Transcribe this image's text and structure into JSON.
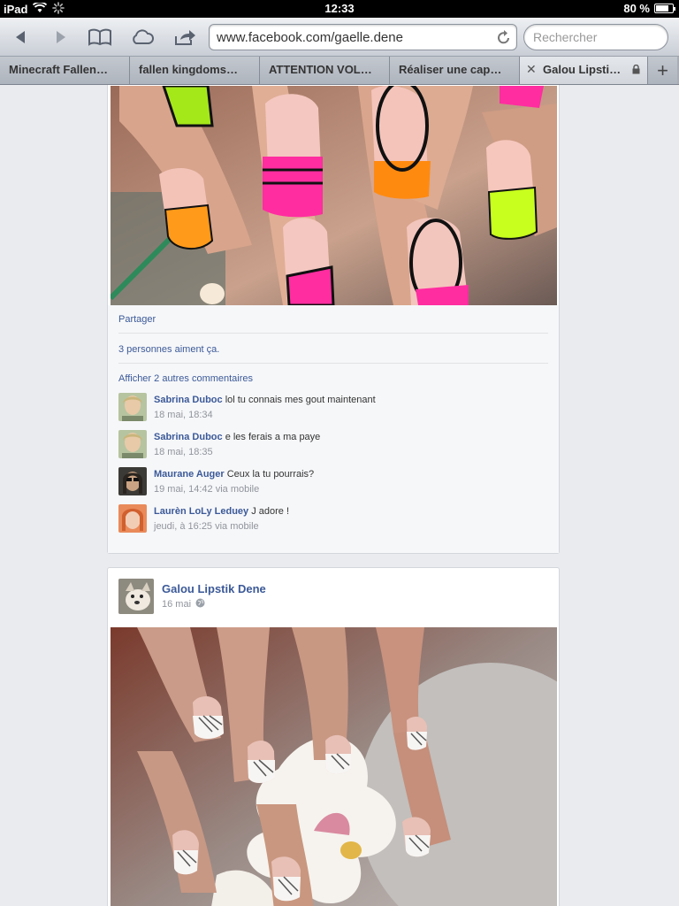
{
  "status": {
    "device": "iPad",
    "time": "12:33",
    "battery_percent_label": "80 %",
    "battery_level": 0.8
  },
  "browser": {
    "url": "www.facebook.com/gaelle.dene",
    "search_placeholder": "Rechercher",
    "icons": {
      "back": "back-arrow-icon",
      "forward": "forward-arrow-icon",
      "bookmarks": "book-icon",
      "icloud": "cloud-icon",
      "share": "share-icon",
      "reload": "reload-icon"
    },
    "tabs": [
      {
        "label": "Minecraft Fallen…",
        "active": false
      },
      {
        "label": "fallen kingdoms…",
        "active": false
      },
      {
        "label": "ATTENTION VOL…",
        "active": false
      },
      {
        "label": "Réaliser une cap…",
        "active": false
      },
      {
        "label": "Galou Lipsti…",
        "active": true
      }
    ],
    "new_tab_label": "+"
  },
  "post1": {
    "share_label": "Partager",
    "likes_label": "3 personnes aiment ça.",
    "more_comments_label": "Afficher 2 autres commentaires",
    "comments": [
      {
        "author": "Sabrina Duboc",
        "text": "lol tu connais mes gout maintenant",
        "meta": "18 mai, 18:34"
      },
      {
        "author": "Sabrina Duboc",
        "text": "e les ferais a ma paye",
        "meta": "18 mai, 18:35"
      },
      {
        "author": "Maurane Auger",
        "text": "Ceux la tu pourrais?",
        "meta": "19 mai, 14:42 via mobile"
      },
      {
        "author": "Laurèn LoLy Leduey",
        "text": "J adore !",
        "meta": "jeudi, à 16:25 via mobile"
      }
    ]
  },
  "post2": {
    "author": "Galou Lipstik Dene",
    "date": "16 mai",
    "privacy_icon": "globe-icon"
  },
  "colors": {
    "link": "#3b5998",
    "page_bg": "#e9ebee",
    "meta_text": "#90949c"
  }
}
